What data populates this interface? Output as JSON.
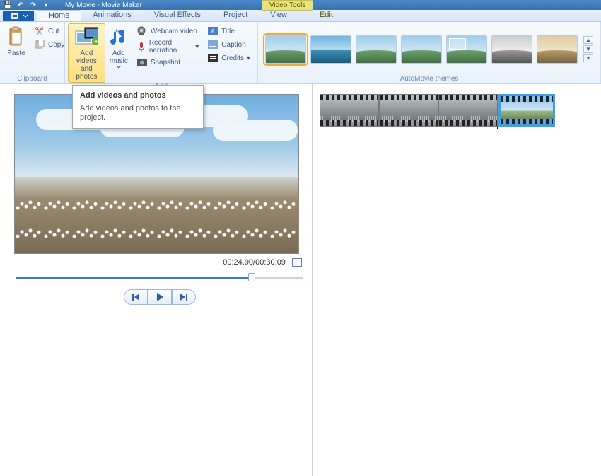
{
  "window": {
    "title": "My Movie - Movie Maker",
    "context_tab": "Video Tools"
  },
  "tabs": {
    "home": "Home",
    "animations": "Animations",
    "vfx": "Visual Effects",
    "project": "Project",
    "view": "View",
    "edit": "Edit"
  },
  "ribbon": {
    "clipboard": {
      "label": "Clipboard",
      "paste": "Paste",
      "cut": "Cut",
      "copy": "Copy"
    },
    "add": {
      "label": "Add",
      "add_videos": "Add videos\nand photos",
      "add_music": "Add\nmusic",
      "webcam": "Webcam video",
      "record": "Record narration",
      "snapshot": "Snapshot",
      "title": "Title",
      "caption": "Caption",
      "credits": "Credits"
    },
    "automovie": {
      "label": "AutoMovie themes"
    }
  },
  "tooltip": {
    "title": "Add videos and photos",
    "body": "Add videos and photos to the project."
  },
  "preview": {
    "time": "00:24.90/00:30.09"
  }
}
